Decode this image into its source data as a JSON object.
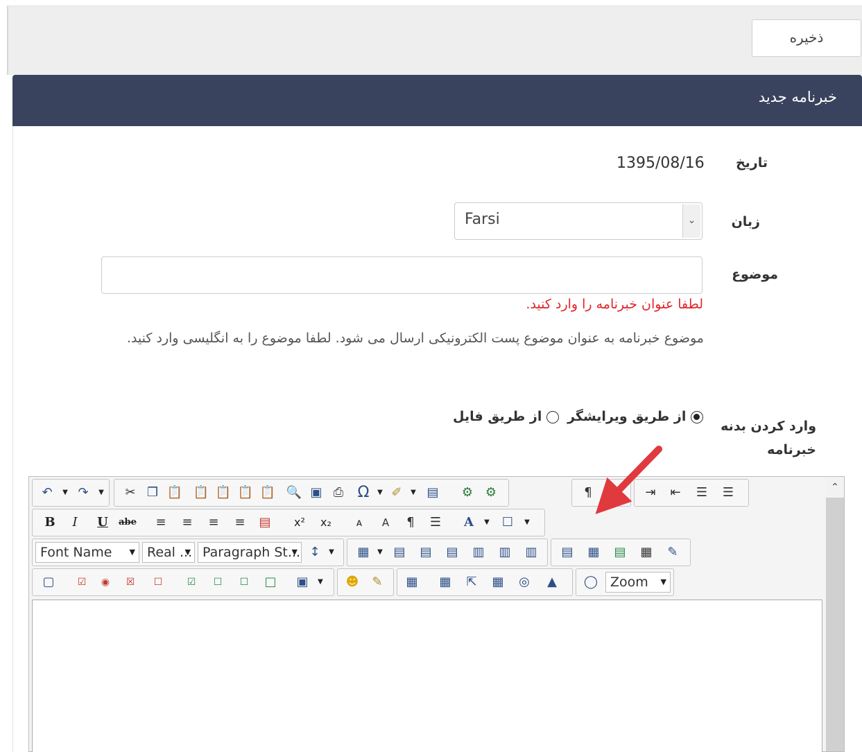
{
  "toolbar": {
    "save_label": "ذخیره"
  },
  "panel": {
    "title": "خبرنامه جدید"
  },
  "form": {
    "date_label": "تاریخ",
    "date_value": "1395/08/16",
    "language_label": "زبان",
    "language_value": "Farsi",
    "subject_label": "موضوع",
    "subject_value": "",
    "subject_error": "لطفا عنوان خبرنامه را وارد کنید.",
    "subject_help": "موضوع خبرنامه به عنوان موضوع پست الکترونیکی ارسال می شود. لطفا موضوع را به انگلیسی وارد کنید.",
    "body_label_line1": "وارد کردن بدنه",
    "body_label_line2": "خبرنامه",
    "radio_editor_label": "از طریق ویرایشگر",
    "radio_file_label": "از طریق فایل",
    "radio_selected": "editor"
  },
  "editor": {
    "font_name_label": "Font Name",
    "font_size_label": "Real ...",
    "paragraph_style_label": "Paragraph St...",
    "zoom_label": "Zoom",
    "row1_icons": [
      "undo-icon",
      "redo-icon",
      "cut-icon",
      "copy-icon",
      "paste-icon",
      "paste-text-icon",
      "paste-word-icon",
      "paste-html-icon",
      "paste-plain-icon",
      "find-icon",
      "select-all-icon",
      "print-icon",
      "special-char-icon",
      "format-stripper-icon",
      "spellcheck-icon",
      "link-icon",
      "unlink-icon",
      "ltr-icon",
      "indent-icon",
      "outdent-icon",
      "numbered-list-icon",
      "bullet-list-icon"
    ],
    "row2_buttons": [
      "B",
      "I",
      "U",
      "abe"
    ],
    "row3_icons": [
      "line-spacing-icon",
      "insert-table-icon",
      "insert-row-above-icon",
      "insert-row-below-icon",
      "delete-row-icon",
      "insert-col-left-icon",
      "insert-col-right-icon",
      "delete-col-icon",
      "table-props-icon",
      "cell-props-icon",
      "row-props-icon",
      "merge-cells-icon",
      "table-wizard-icon"
    ],
    "row4_icons": [
      "form-icon",
      "checkbox-icon",
      "radio-icon",
      "select-icon",
      "textarea-icon",
      "button-icon",
      "submit-icon",
      "reset-icon",
      "hidden-field-icon",
      "shape-icon",
      "emoji-icon",
      "snippet-icon",
      "image-icon",
      "image-map-icon",
      "flash-icon",
      "media-icon",
      "document-icon",
      "template-icon",
      "module-icon"
    ]
  }
}
